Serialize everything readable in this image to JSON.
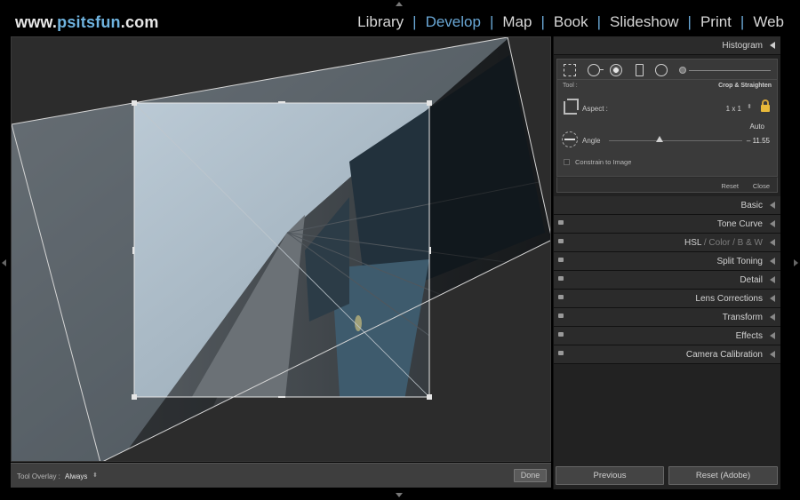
{
  "brand": {
    "prefix": "www.",
    "accent": "psitsfun",
    "suffix": ".com"
  },
  "modules": [
    "Library",
    "Develop",
    "Map",
    "Book",
    "Slideshow",
    "Print",
    "Web"
  ],
  "active_module": "Develop",
  "colors": {
    "accent": "#6aa8d6",
    "lock": "#e8b93a",
    "panel_bg": "#222222"
  },
  "toolbar": {
    "overlay_label": "Tool Overlay :",
    "overlay_value": "Always",
    "done_label": "Done"
  },
  "histogram": {
    "title": "Histogram"
  },
  "tool_strip": {
    "icons": [
      "crop-overlay-icon",
      "spot-removal-icon",
      "red-eye-icon",
      "graduated-filter-icon",
      "radial-filter-icon",
      "adjustment-brush-icon"
    ]
  },
  "crop": {
    "tool_label": "Tool :",
    "tool_name": "Crop & Straighten",
    "aspect_label": "Aspect :",
    "aspect_value": "1 x 1",
    "auto_label": "Auto",
    "angle_label": "Angle",
    "angle_value": "– 11.55",
    "constrain_label": "Constrain to Image",
    "reset_label": "Reset",
    "close_label": "Close"
  },
  "panels": [
    {
      "title": "Basic"
    },
    {
      "title": "Tone Curve"
    },
    {
      "title": "HSL",
      "sub1": "Color",
      "sub2": "B & W"
    },
    {
      "title": "Split Toning"
    },
    {
      "title": "Detail"
    },
    {
      "title": "Lens Corrections"
    },
    {
      "title": "Transform"
    },
    {
      "title": "Effects"
    },
    {
      "title": "Camera Calibration"
    }
  ],
  "bottom": {
    "previous_label": "Previous",
    "reset_label": "Reset (Adobe)"
  }
}
